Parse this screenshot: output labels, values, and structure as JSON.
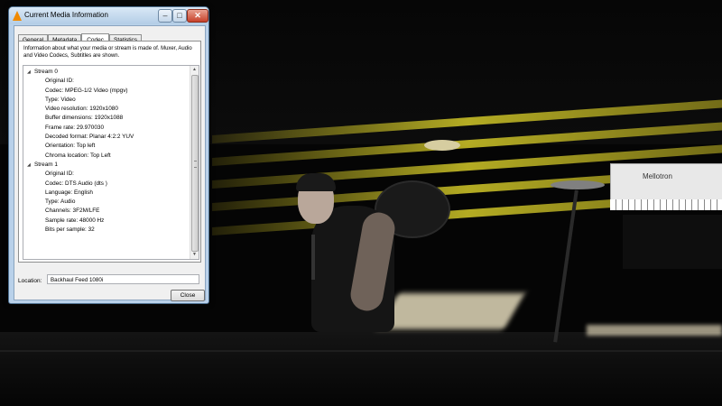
{
  "window": {
    "title": "Current Media Information",
    "controls": {
      "minimize": "‒",
      "maximize": "□",
      "close": "✕"
    }
  },
  "tabs": [
    {
      "label": "General"
    },
    {
      "label": "Metadata"
    },
    {
      "label": "Codec",
      "active": true
    },
    {
      "label": "Statistics"
    }
  ],
  "codec": {
    "description": "Information about what your media or stream is made of. Muxer, Audio and Video Codecs, Subtitles are shown.",
    "streams": [
      {
        "label": "Stream 0",
        "fields": [
          "Original ID:",
          "Codec: MPEG-1/2 Video (mpgv)",
          "Type: Video",
          "Video resolution: 1920x1080",
          "Buffer dimensions: 1920x1088",
          "Frame rate: 29.970030",
          "Decoded format: Planar 4:2:2 YUV",
          "Orientation: Top left",
          "Chroma location: Top Left"
        ]
      },
      {
        "label": "Stream 1",
        "fields": [
          "Original ID:",
          "Codec: DTS Audio (dts )",
          "Language: English",
          "Type: Audio",
          "Channels: 3F2M/LFE",
          "Sample rate: 48000 Hz",
          "Bits per sample: 32"
        ]
      }
    ]
  },
  "location": {
    "label": "Location:",
    "value": "Backhaul Feed 1080i"
  },
  "buttons": {
    "close": "Close"
  },
  "background": {
    "keyboard_brand": "Mellotron"
  }
}
